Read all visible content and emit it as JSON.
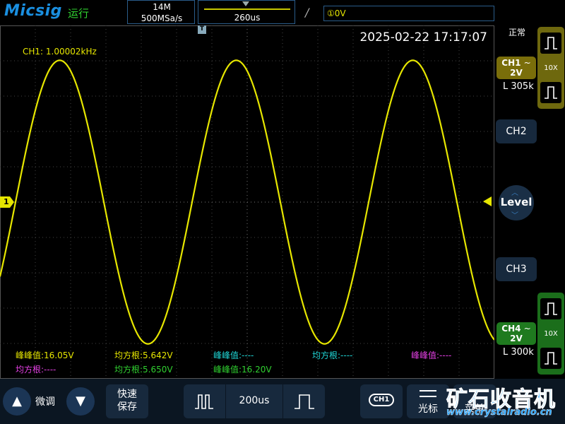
{
  "header": {
    "brand": "Micsig",
    "run_status": "运行",
    "memory_depth": "14M",
    "sample_rate": "500MSa/s",
    "trigger_delay": "260us",
    "trigger_slope_icon": "rising-edge-icon",
    "trigger_level": "①0V"
  },
  "display": {
    "timestamp": "2025-02-22 17:17:07",
    "frequency_readout": "CH1: 1.00002kHz",
    "ch1_marker": "1",
    "trigger_position_marker": "T"
  },
  "measurements": {
    "row1": [
      {
        "label": "峰峰值:16.05V",
        "color": "#e6e600"
      },
      {
        "label": "均方根:5.642V",
        "color": "#e6e600"
      },
      {
        "label": "峰峰值:----",
        "color": "#1fd6d6"
      },
      {
        "label": "均方根:----",
        "color": "#1fd6d6"
      },
      {
        "label": "峰峰值:----",
        "color": "#e23fe2"
      }
    ],
    "row2": [
      {
        "label": "均方根:----",
        "color": "#e23fe2"
      },
      {
        "label": "均方根:5.650V",
        "color": "#30d030"
      },
      {
        "label": "峰峰值:16.20V",
        "color": "#30d030"
      }
    ]
  },
  "right_panel": {
    "acq_mode": "正常",
    "ch1": {
      "name": "CH1",
      "coupling_icon": "ac-coupling-icon",
      "scale": "2V",
      "probe": "L 305k",
      "attenuation": "10X",
      "color": "#e6e600"
    },
    "ch2": {
      "name": "CH2"
    },
    "level": {
      "label": "Level"
    },
    "ch3": {
      "name": "CH3"
    },
    "ch4": {
      "name": "CH4",
      "coupling_icon": "ac-coupling-icon",
      "scale": "2V",
      "probe": "L 300k",
      "attenuation": "10X",
      "color": "#30d030"
    }
  },
  "bottom_bar": {
    "fine_adjust": "微调",
    "quick_save_line1": "快速",
    "quick_save_line2": "保存",
    "horizontal_scale": "200us",
    "channel_select": "CH1",
    "cursor": "光标",
    "menu": "菜单"
  },
  "watermark": {
    "title": "矿石收音机",
    "url": "www.crystalradio.cn"
  },
  "waveform": {
    "channel": "CH1",
    "color": "#e6e600",
    "frequency_hz": 1000.02,
    "peak_to_peak_v": 16.05,
    "vertical_scale_v_per_div": 2,
    "time_per_div_us": 200
  }
}
